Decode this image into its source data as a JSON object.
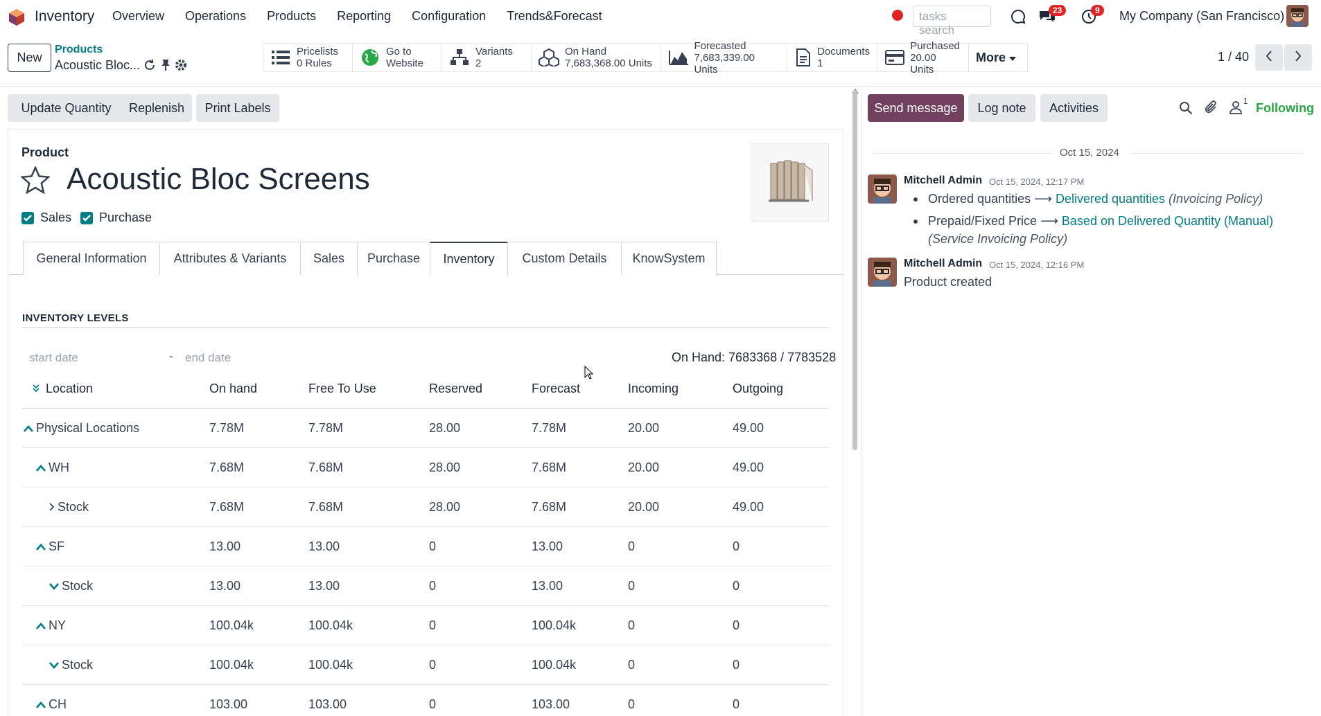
{
  "navbar": {
    "app_name": "Inventory",
    "menu": [
      "Overview",
      "Operations",
      "Products",
      "Reporting",
      "Configuration",
      "Trends&Forecast"
    ],
    "search_placeholder": "tasks search",
    "messages_badge": "23",
    "activities_badge": "9",
    "company": "My Company (San Francisco)"
  },
  "control": {
    "new_label": "New",
    "breadcrumb_parent": "Products",
    "breadcrumb_current": "Acoustic Bloc...",
    "smart_buttons": [
      {
        "line1": "Pricelists",
        "line2": "0 Rules",
        "icon": "list-icon"
      },
      {
        "line1": "Go to",
        "line2": "Website",
        "icon": "globe-icon"
      },
      {
        "line1": "Variants",
        "line2": "2",
        "icon": "sitemap-icon"
      },
      {
        "line1": "On Hand",
        "line2": "7,683,368.00 Units",
        "icon": "cubes-icon"
      },
      {
        "line1": "Forecasted",
        "line2": "7,683,339.00 Units",
        "icon": "area-chart-icon"
      },
      {
        "line1": "Documents",
        "line2": "1",
        "icon": "file-icon"
      },
      {
        "line1": "Purchased",
        "line2": "20.00 Units",
        "icon": "credit-card-icon"
      }
    ],
    "more_label": "More",
    "pager": "1 / 40"
  },
  "actions": {
    "update_quantity": "Update Quantity",
    "replenish": "Replenish",
    "print_labels": "Print Labels"
  },
  "product": {
    "type_label": "Product",
    "name": "Acoustic Bloc Screens",
    "sales_label": "Sales",
    "purchase_label": "Purchase",
    "sales_checked": true,
    "purchase_checked": true
  },
  "tabs": [
    "General Information",
    "Attributes & Variants",
    "Sales",
    "Purchase",
    "Inventory",
    "Custom Details",
    "KnowSystem"
  ],
  "active_tab": "Inventory",
  "inventory": {
    "section_title": "INVENTORY LEVELS",
    "start_placeholder": "start date",
    "dash": "-",
    "end_placeholder": "end date",
    "on_hand_total": "On Hand: 7683368 / 7783528",
    "columns": [
      "Location",
      "On hand",
      "Free To Use",
      "Reserved",
      "Forecast",
      "Incoming",
      "Outgoing"
    ],
    "rows": [
      {
        "location": "Physical Locations",
        "chev": "up",
        "indent": 0,
        "values": [
          "7.78M",
          "7.78M",
          "28.00",
          "7.78M",
          "20.00",
          "49.00"
        ]
      },
      {
        "location": "WH",
        "chev": "up",
        "indent": 1,
        "values": [
          "7.68M",
          "7.68M",
          "28.00",
          "7.68M",
          "20.00",
          "49.00"
        ]
      },
      {
        "location": "Stock",
        "chev": "right",
        "indent": 2,
        "values": [
          "7.68M",
          "7.68M",
          "28.00",
          "7.68M",
          "20.00",
          "49.00"
        ]
      },
      {
        "location": "SF",
        "chev": "up",
        "indent": 1,
        "values": [
          "13.00",
          "13.00",
          "0",
          "13.00",
          "0",
          "0"
        ]
      },
      {
        "location": "Stock",
        "chev": "down",
        "indent": 2,
        "values": [
          "13.00",
          "13.00",
          "0",
          "13.00",
          "0",
          "0"
        ]
      },
      {
        "location": "NY",
        "chev": "up",
        "indent": 1,
        "values": [
          "100.04k",
          "100.04k",
          "0",
          "100.04k",
          "0",
          "0"
        ]
      },
      {
        "location": "Stock",
        "chev": "down",
        "indent": 2,
        "values": [
          "100.04k",
          "100.04k",
          "0",
          "100.04k",
          "0",
          "0"
        ]
      },
      {
        "location": "CH",
        "chev": "up",
        "indent": 1,
        "values": [
          "103.00",
          "103.00",
          "0",
          "103.00",
          "0",
          "0"
        ]
      }
    ]
  },
  "chatter": {
    "send_message": "Send message",
    "log_note": "Log note",
    "activities": "Activities",
    "follower_count": "1",
    "following": "Following",
    "date_separator": "Oct 15, 2024",
    "messages": [
      {
        "author": "Mitchell Admin",
        "time": "Oct 15, 2024, 12:17 PM",
        "changes": [
          {
            "old": "Ordered quantities",
            "new": "Delivered quantities",
            "field": "(Invoicing Policy)"
          },
          {
            "old": "Prepaid/Fixed Price",
            "new": "Based on Delivered Quantity (Manual)",
            "field": "(Service Invoicing Policy)"
          }
        ]
      },
      {
        "author": "Mitchell Admin",
        "time": "Oct 15, 2024, 12:16 PM",
        "body": "Product created"
      }
    ]
  },
  "colors": {
    "brand": "#71405e",
    "link": "#017e84",
    "badge": "#e02424",
    "following": "#28a745"
  }
}
